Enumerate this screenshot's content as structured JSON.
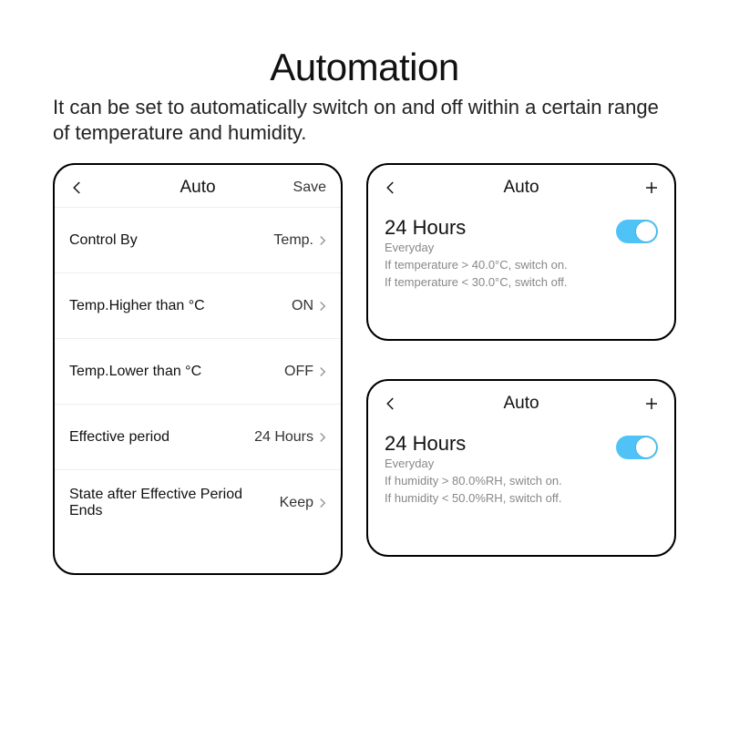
{
  "heading": "Automation",
  "subheading": "It can be set to automatically switch on and off within a certain range of temperature and humidity.",
  "left": {
    "nav_title": "Auto",
    "nav_action": "Save",
    "rows": [
      {
        "label": "Control By",
        "value": "Temp."
      },
      {
        "label": "Temp.Higher than  °C",
        "value": "ON",
        "deg": true
      },
      {
        "label": "Temp.Lower than  °C",
        "value": "OFF",
        "deg": true
      },
      {
        "label": "Effective period",
        "value": "24 Hours"
      },
      {
        "label": "State after Effective Period Ends",
        "value": "Keep"
      }
    ]
  },
  "right1": {
    "nav_title": "Auto",
    "title": "24 Hours",
    "sub": "Everyday",
    "line1": "If temperature > 40.0°C, switch on.",
    "line2": "If temperature < 30.0°C, switch off."
  },
  "right2": {
    "nav_title": "Auto",
    "title": "24 Hours",
    "sub": "Everyday",
    "line1": "If humidity > 80.0%RH, switch on.",
    "line2": "If humidity < 50.0%RH, switch off."
  }
}
